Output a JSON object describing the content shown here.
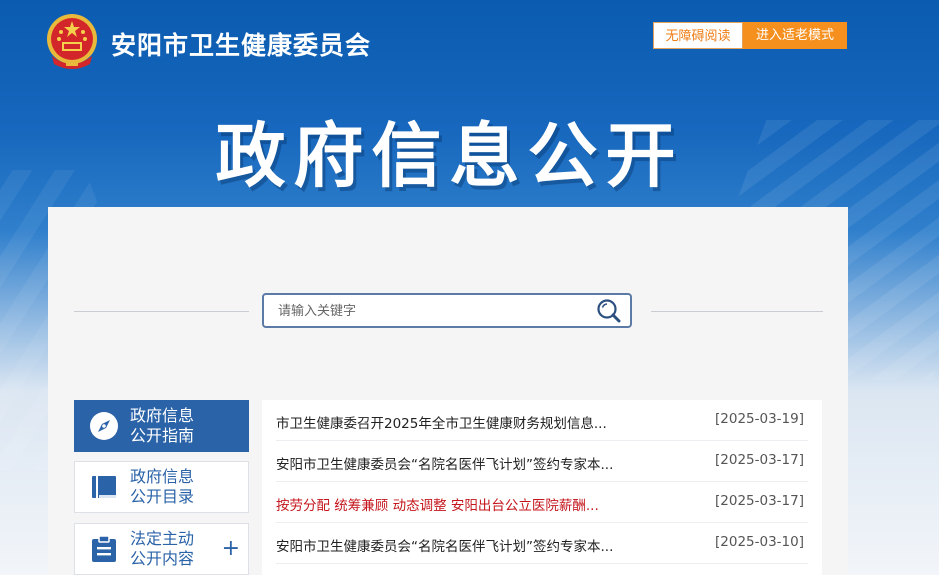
{
  "header": {
    "site_title": "安阳市卫生健康委员会",
    "accessibility_label": "无障碍阅读",
    "elder_mode_label": "进入适老模式"
  },
  "banner": {
    "title": "政府信息公开"
  },
  "search": {
    "placeholder": "请输入关键字",
    "value": ""
  },
  "sidebar": {
    "items": [
      {
        "label_line1": "政府信息",
        "label_line2": "公开指南",
        "icon": "compass-icon",
        "active": true
      },
      {
        "label_line1": "政府信息",
        "label_line2": "公开目录",
        "icon": "book-icon",
        "active": false
      },
      {
        "label_line1": "法定主动",
        "label_line2": "公开内容",
        "icon": "clipboard-icon",
        "active": false,
        "expand": "+"
      }
    ]
  },
  "news": {
    "items": [
      {
        "title": "市卫生健康委召开2025年全市卫生健康财务规划信息...",
        "date": "[2025-03-19]",
        "highlight": false
      },
      {
        "title": "安阳市卫生健康委员会“名院名医伴飞计划”签约专家本...",
        "date": "[2025-03-17]",
        "highlight": false
      },
      {
        "title": "按劳分配 统筹兼顾 动态调整 安阳出台公立医院薪酬...",
        "date": "[2025-03-17]",
        "highlight": true
      },
      {
        "title": "安阳市卫生健康委员会“名院名医伴飞计划”签约专家本...",
        "date": "[2025-03-10]",
        "highlight": false
      }
    ]
  },
  "colors": {
    "brand_blue": "#2b63a8",
    "accent_orange": "#f58f1e",
    "highlight_red": "#c4161c"
  }
}
